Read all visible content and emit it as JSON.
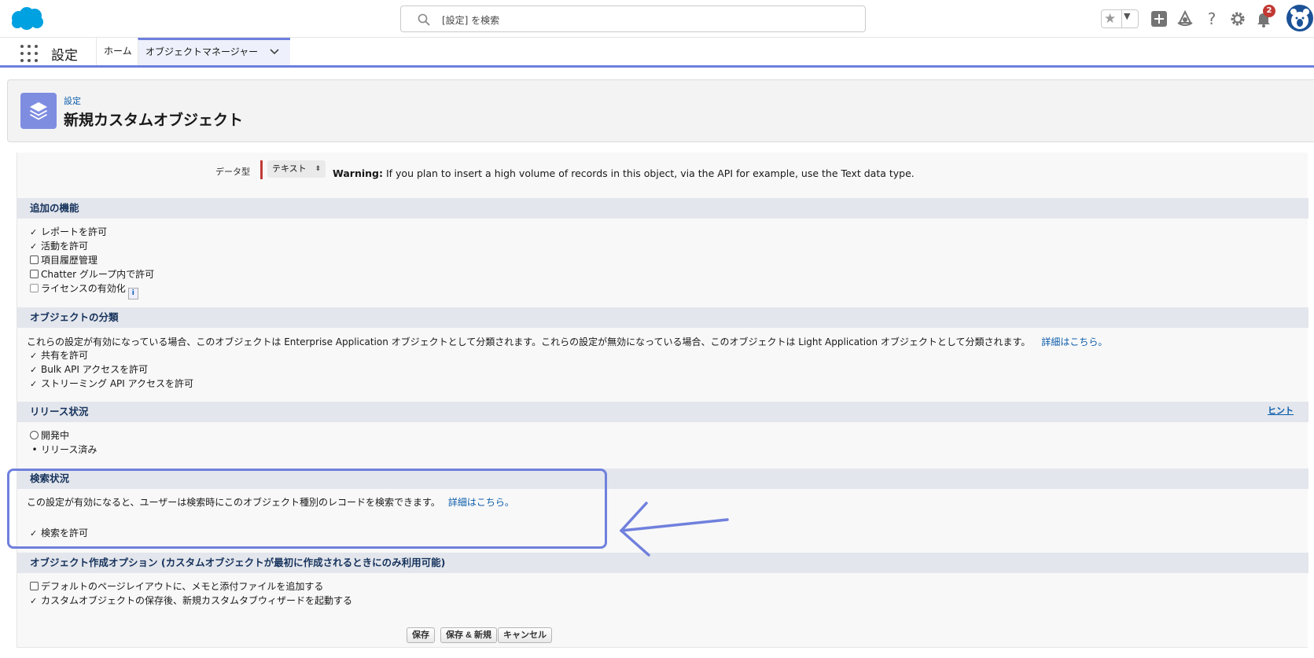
{
  "header": {
    "search_placeholder": "[設定] を検索",
    "notification_count": "2",
    "icons": [
      "salesforce-cloud-logo",
      "search-icon",
      "star-icon",
      "chevron-down-icon",
      "plus-icon",
      "trailhead-icon",
      "help-icon",
      "gear-icon",
      "bell-icon",
      "avatar"
    ]
  },
  "nav": {
    "app_name": "設定",
    "tabs": [
      {
        "label": "ホーム"
      },
      {
        "label": "オブジェクトマネージャー"
      }
    ]
  },
  "page": {
    "breadcrumb": "設定",
    "title": "新規カスタムオブジェクト"
  },
  "datatype": {
    "label": "データ型",
    "selected": "テキスト",
    "warning_bold": "Warning:",
    "warning_text": " If you plan to insert a high volume of records in this object, via the API for example, use the Text data type."
  },
  "sections": {
    "optional_features": {
      "title": "追加の機能",
      "items": [
        {
          "label": "レポートを許可",
          "checked": true
        },
        {
          "label": "活動を許可",
          "checked": true
        },
        {
          "label": "項目履歴管理",
          "checked": false
        },
        {
          "label": "Chatter グループ内で許可",
          "checked": false
        },
        {
          "label": "ライセンスの有効化",
          "checked": false
        }
      ],
      "info_icon": "i"
    },
    "classification": {
      "title": "オブジェクトの分類",
      "description": "これらの設定が有効になっている場合、このオブジェクトは Enterprise Application オブジェクトとして分類されます。これらの設定が無効になっている場合、このオブジェクトは Light Application オブジェクトとして分類されます。",
      "link": "詳細はこちら。",
      "items": [
        {
          "label": "共有を許可",
          "checked": true
        },
        {
          "label": "Bulk API アクセスを許可",
          "checked": true
        },
        {
          "label": "ストリーミング API アクセスを許可",
          "checked": true
        }
      ]
    },
    "deployment": {
      "title": "リリース状況",
      "hint": "ヒント",
      "options": [
        {
          "label": "開発中",
          "selected": false
        },
        {
          "label": "リリース済み",
          "selected": true
        }
      ]
    },
    "search_status": {
      "title": "検索状況",
      "description": "この設定が有効になると、ユーザーは検索時にこのオブジェクト種別のレコードを検索できます。",
      "link": "詳細はこちら。",
      "items": [
        {
          "label": "検索を許可",
          "checked": true
        }
      ]
    },
    "creation_options": {
      "title": "オブジェクト作成オプション (カスタムオブジェクトが最初に作成されるときにのみ利用可能)",
      "items": [
        {
          "label": "デフォルトのページレイアウトに、メモと添付ファイルを追加する",
          "checked": false
        },
        {
          "label": "カスタムオブジェクトの保存後、新規カスタムタブウィザードを起動する",
          "checked": true
        }
      ]
    }
  },
  "buttons": {
    "save": "保存",
    "save_new": "保存 & 新規",
    "cancel": "キャンセル"
  },
  "colors": {
    "brand": "#00a1e0",
    "accent": "#6d7fde",
    "annotation": "#7080dd",
    "link": "#0b5cab",
    "required": "#c23934"
  }
}
